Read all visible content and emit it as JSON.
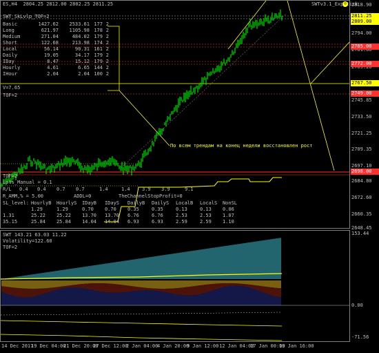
{
  "header": {
    "symbol_line": "ES,H4  2804.25 2812.00 2802.25 2811.25",
    "indicator": "SWTv3.1_Exp_tick",
    "indicator_icon": "smiley-icon"
  },
  "info": {
    "title": "SWT_SkLvlp_TOF=2",
    "rows": [
      {
        "name": "Basic",
        "a": "1427.62",
        "b": "2533.61",
        "c": "177",
        "d": "2"
      },
      {
        "name": "Long",
        "a": "621.97",
        "b": "1105.98",
        "c": "178",
        "d": "2"
      },
      {
        "name": "Medium",
        "a": "271.04",
        "b": "484.02",
        "c": "179",
        "d": "2"
      },
      {
        "name": "Short",
        "a": "122.68",
        "b": "213.98",
        "c": "174",
        "d": "2"
      },
      {
        "name": "Local",
        "a": "56.14",
        "b": "90.31",
        "c": "161",
        "d": "2"
      },
      {
        "name": "Daily",
        "a": "19.05",
        "b": "34.17",
        "c": "179",
        "d": "2"
      },
      {
        "name": "IDay",
        "a": "8.47",
        "b": "15.12",
        "c": "179",
        "d": "2"
      },
      {
        "name": "Hourly",
        "a": "4.61",
        "b": "6.65",
        "c": "144",
        "d": "2"
      },
      {
        "name": "IHour",
        "a": "2.04",
        "b": "2.04",
        "c": "100",
        "d": "2"
      }
    ],
    "v_line": "V=7.65",
    "tof_line": "TOF=2"
  },
  "annotation": "По всем трендам на конец недели восстановлен рост",
  "lower_info": {
    "tof": "TOF=2",
    "lots": "Lots_Manual = 0.1",
    "rl_label": "R/L",
    "rl_values": [
      "0.4",
      "0.4",
      "0.7",
      "0.7",
      "1.4",
      "1.4",
      "3.9",
      "3.9",
      "9.1"
    ],
    "ramm": "R_AMM,% = 5.00",
    "addl": "ADDL=0",
    "stop": "TheChannelStopProfit=0",
    "headers": [
      "SL_level:",
      "HourlyB",
      "HourlyS",
      "IDayB",
      "IDayS",
      "DailyB",
      "DailyS",
      "LocalB",
      "LocalS",
      "NonSL"
    ],
    "rows": [
      [
        "",
        "1.29",
        "1.29",
        "0.70",
        "0.70",
        "0.35",
        "0.35",
        "0.13",
        "0.13",
        "0.06"
      ],
      [
        "",
        "25.22",
        "25.22",
        "13.70",
        "13.70",
        "6.76",
        "6.76",
        "2.53",
        "2.53",
        "1.07"
      ],
      [
        "",
        "25.84",
        "25.84",
        "14.04",
        "14.04",
        "6.93",
        "6.93",
        "2.59",
        "2.59",
        "1.10"
      ]
    ],
    "left_partial": [
      "",
      "1.31",
      "35.15"
    ]
  },
  "subwindow": {
    "title": "SWT 143.21 63.03 11.22",
    "volatility": "Volatility=122.60",
    "tof": "TOF=2"
  },
  "price_axis": {
    "ticks": [
      "2818.90",
      "2806.45",
      "2794.00",
      "2781.60",
      "2769.20",
      "2757.50",
      "2745.85",
      "2733.50",
      "2721.25",
      "2709.35",
      "2697.10",
      "2684.80",
      "2672.60",
      "2660.35",
      "2648.45"
    ],
    "labels": [
      {
        "text": "2811.25",
        "color": "#ffff00"
      },
      {
        "text": "2809.00",
        "color": "#ffff00"
      },
      {
        "text": "2785.00",
        "color": "#ff3030"
      },
      {
        "text": "2772.00",
        "color": "#ff3030"
      },
      {
        "text": "2767.50",
        "color": "#ffff00"
      },
      {
        "text": "2749.00",
        "color": "#ff3030"
      },
      {
        "text": "2698.00",
        "color": "#ff3030"
      }
    ]
  },
  "sub_axis": {
    "ticks": [
      "153.44",
      "0.00",
      "-71.56"
    ]
  },
  "time_axis": [
    "14 Dec 2017",
    "19 Dec 04:00",
    "21 Dec 20:00",
    "27 Dec 12:00",
    "2 Jan 04:00",
    "4 Jan 20:00",
    "9 Jan 12:00",
    "12 Jan 04:00",
    "17 Jan 00:00",
    "19 Jan 16:00"
  ]
}
